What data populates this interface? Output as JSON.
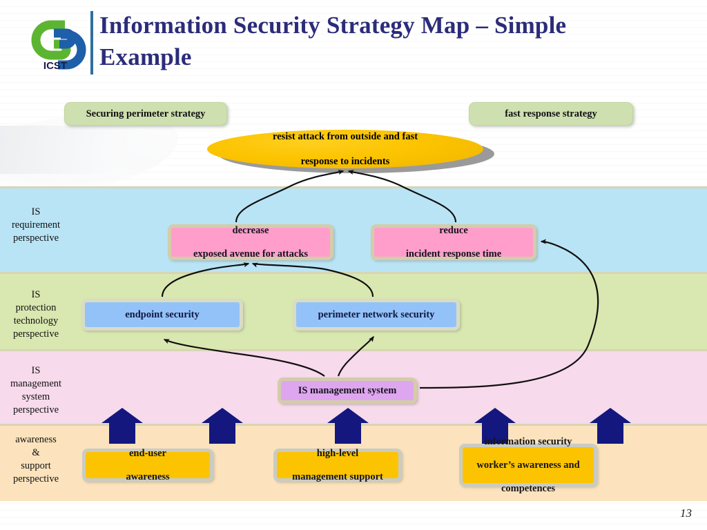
{
  "header": {
    "title": "Information Security Strategy Map – Simple Example",
    "logo_text": "ICST",
    "logo_name": "icst-logo",
    "accent_color": "#2c2c7a",
    "rule_color": "#2e6f9e"
  },
  "strategies": [
    {
      "id": "securing-perimeter",
      "label": "Securing  perimeter strategy",
      "color": "#cfe0b0"
    },
    {
      "id": "fast-response",
      "label": "fast response strategy",
      "color": "#cfe0b0"
    }
  ],
  "goal": {
    "label": "resist attack from outside and fast response to incidents",
    "line1": "resist attack from outside and fast",
    "line2": "response to incidents",
    "color": "#fcc400",
    "shadow_color": "#9a9a9a",
    "shape": "ellipse"
  },
  "bands": [
    {
      "id": "is-requirement-perspective",
      "label": "IS requirement perspective",
      "lines": [
        "IS",
        "requirement",
        "perspective"
      ],
      "color": "#b9e4f5"
    },
    {
      "id": "is-protection-technology-perspective",
      "label": "IS protection technology perspective",
      "lines": [
        "IS",
        "protection",
        "technology",
        "perspective"
      ],
      "color": "#d9e7b0"
    },
    {
      "id": "is-management-system-perspective",
      "label": "IS management system perspective",
      "lines": [
        "IS",
        "management",
        "system",
        "perspective"
      ],
      "color": "#f7daeb"
    },
    {
      "id": "awareness-support-perspective",
      "label": "awareness & support perspective",
      "lines": [
        "awareness",
        "&",
        "support",
        "perspective"
      ],
      "color": "#fce3bd"
    }
  ],
  "nodes": {
    "requirement": [
      {
        "id": "decrease-exposed-avenue",
        "line1": "decrease",
        "line2": "exposed avenue for attacks",
        "color": "#ff9ecb"
      },
      {
        "id": "reduce-incident-response-time",
        "line1": "reduce",
        "line2": "incident response time",
        "color": "#ff9ecb"
      }
    ],
    "protection": [
      {
        "id": "endpoint-security",
        "line1": "endpoint security",
        "color": "#93c2f8"
      },
      {
        "id": "perimeter-network-security",
        "line1": "perimeter network security",
        "color": "#93c2f8"
      }
    ],
    "management": [
      {
        "id": "is-management-system",
        "line1": "IS management system",
        "color": "#dfa6f0"
      }
    ],
    "awareness": [
      {
        "id": "end-user-awareness",
        "line1": "end-user",
        "line2": "awareness",
        "color": "#fcc400"
      },
      {
        "id": "high-level-management-support",
        "line1": "high-level",
        "line2": "management  support",
        "color": "#fcc400"
      },
      {
        "id": "information-security-worker-competences",
        "line1": "information security",
        "line2": "worker’s awareness and",
        "line3": "competences",
        "color": "#fcc400"
      }
    ]
  },
  "connectors": {
    "curve_color": "#101010",
    "block_arrow_color": "#14177e",
    "block_arrow_count": 5
  },
  "footer": {
    "page_number": "13"
  }
}
